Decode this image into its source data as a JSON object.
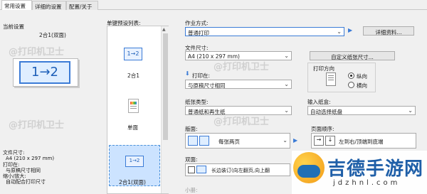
{
  "tabs": [
    {
      "label": "常用设置"
    },
    {
      "label": "详细的设置"
    },
    {
      "label": "配置/关于"
    }
  ],
  "left": {
    "current_label": "当前设置",
    "current_value": "2合1(双面)",
    "preview_text": "1→2",
    "summary": [
      "文件尺寸:",
      "  A4 (210 x 297 mm)",
      "打印在:",
      "  与原稿尺寸相同",
      "缩小/放大:",
      "  自动配合打印尺寸"
    ]
  },
  "presets": {
    "label": "单键预设列表:",
    "items": [
      {
        "icon_text": "1→2",
        "label": "2合1"
      },
      {
        "icon_text": "",
        "label": "单面"
      },
      {
        "icon_text": "1→2",
        "label": "2合1(双面)"
      }
    ]
  },
  "form": {
    "job_method_label": "作业方式:",
    "job_method_value": "普通打印",
    "details_button": "详细资料...",
    "paper_size_label": "文件尺寸:",
    "paper_size_value": "A4 (210 x 297 mm)",
    "custom_size_button": "自定义纸张尺寸...",
    "print_on_label": "打印在:",
    "print_on_value": "与原稿尺寸相同",
    "orientation_label": "打印方向",
    "orientation_portrait": "纵向",
    "orientation_landscape": "横向",
    "paper_type_label": "纸张类型:",
    "paper_type_value": "普通纸和再生纸",
    "input_tray_label": "输入纸盒:",
    "input_tray_value": "自动选择纸盘",
    "layout_label": "版面:",
    "layout_value": "每张两页",
    "page_order_label": "页面顺序:",
    "page_order_value": "左到右/顶端到底端",
    "duplex_label": "双面:",
    "duplex_value": "长边装订(向左翻页,向上翻",
    "booklet_label": "小册:"
  },
  "watermarks": [
    "@打印机卫士",
    "@打印机卫士",
    "@打印机卫士",
    "@打印机卫士"
  ],
  "logo": {
    "text": "吉德手游网",
    "url": "jdzhnl.com"
  }
}
